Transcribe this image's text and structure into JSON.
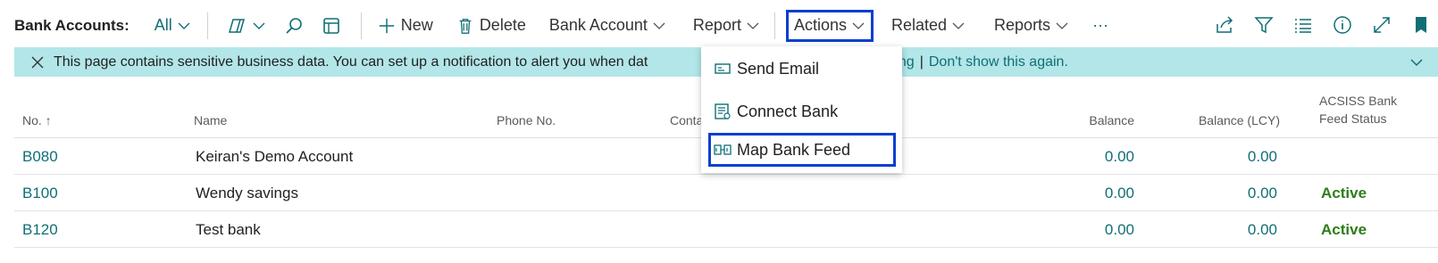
{
  "toolbar": {
    "title": "Bank Accounts:",
    "filter": "All",
    "new": "New",
    "delete": "Delete",
    "bank_account": "Bank Account",
    "report": "Report",
    "actions": "Actions",
    "related": "Related",
    "reports": "Reports",
    "more": "···"
  },
  "notification": {
    "message": "This page contains sensitive business data. You can set up a notification to alert you when dat",
    "link_monitoring": "onitoring",
    "separator": "|",
    "link_dont_show": "Don't show this again."
  },
  "dropdown": {
    "items": [
      {
        "label": "Send Email",
        "icon": "email-icon"
      },
      {
        "label": "Connect Bank",
        "icon": "bank-connect-icon"
      },
      {
        "label": "Map Bank Feed",
        "icon": "bank-feed-map-icon"
      }
    ]
  },
  "table": {
    "headers": {
      "no": "No. ↑",
      "name": "Name",
      "phone": "Phone No.",
      "contact": "Conta",
      "balance": "Balance",
      "balance_lcy": "Balance (LCY)",
      "feed_status_line1": "ACSISS Bank",
      "feed_status_line2": "Feed Status"
    },
    "rows": [
      {
        "no": "B080",
        "name": "Keiran's Demo Account",
        "balance": "0.00",
        "balance_lcy": "0.00",
        "status": ""
      },
      {
        "no": "B100",
        "name": "Wendy savings",
        "balance": "0.00",
        "balance_lcy": "0.00",
        "status": "Active"
      },
      {
        "no": "B120",
        "name": "Test bank",
        "balance": "0.00",
        "balance_lcy": "0.00",
        "status": "Active"
      }
    ]
  },
  "colors": {
    "accent": "#0f6f75",
    "notification_bg": "#b3e6e8",
    "highlight_border": "#0a3fcf",
    "status_active": "#2e7d1a"
  }
}
